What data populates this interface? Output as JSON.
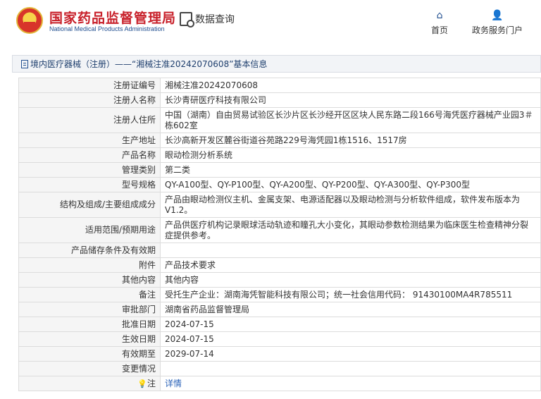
{
  "header": {
    "site_title": "国家药品监督管理局",
    "site_subtitle": "National Medical Products Administration",
    "query_label": "数据查询",
    "nav": {
      "home": "首页",
      "service": "政务服务门户"
    }
  },
  "breadcrumb": {
    "text": "境内医疗器械（注册）——“湘械注准20242070608”基本信息"
  },
  "detail": {
    "rows": [
      {
        "label": "注册证编号",
        "value": "湘械注准20242070608"
      },
      {
        "label": "注册人名称",
        "value": "长沙青研医疗科技有限公司"
      },
      {
        "label": "注册人住所",
        "value": "中国（湖南）自由贸易试验区长沙片区长沙经开区区块人民东路二段166号海凭医疗器械产业园3＃栋602室"
      },
      {
        "label": "生产地址",
        "value": "长沙高新开发区麓谷街道谷苑路229号海凭园1栋1516、1517房"
      },
      {
        "label": "产品名称",
        "value": "眼动检测分析系统"
      },
      {
        "label": "管理类别",
        "value": "第二类"
      },
      {
        "label": "型号规格",
        "value": "QY-A100型、QY-P100型、QY-A200型、QY-P200型、QY-A300型、QY-P300型"
      },
      {
        "label": "结构及组成/主要组成成分",
        "value": "产品由眼动检测仪主机、金属支架、电源适配器以及眼动检测与分析软件组成，软件发布版本为V1.2。"
      },
      {
        "label": "适用范围/预期用途",
        "value": "产品供医疗机构记录眼球活动轨迹和瞳孔大小变化，其眼动参数检测结果为临床医生检查精神分裂症提供参考。"
      },
      {
        "label": "产品储存条件及有效期",
        "value": ""
      },
      {
        "label": "附件",
        "value": "产品技术要求"
      },
      {
        "label": "其他内容",
        "value": "其他内容"
      },
      {
        "label": "备注",
        "value": "受托生产企业：湖南海凭智能科技有限公司；统一社会信用代码： 91430100MA4R785511"
      },
      {
        "label": "审批部门",
        "value": "湖南省药品监督管理局"
      },
      {
        "label": "批准日期",
        "value": "2024-07-15"
      },
      {
        "label": "生效日期",
        "value": "2024-07-15"
      },
      {
        "label": "有效期至",
        "value": "2029-07-14"
      },
      {
        "label": "变更情况",
        "value": ""
      }
    ],
    "note_label": "注",
    "note_icon": "lightbulb-icon",
    "note_link": "详情"
  }
}
